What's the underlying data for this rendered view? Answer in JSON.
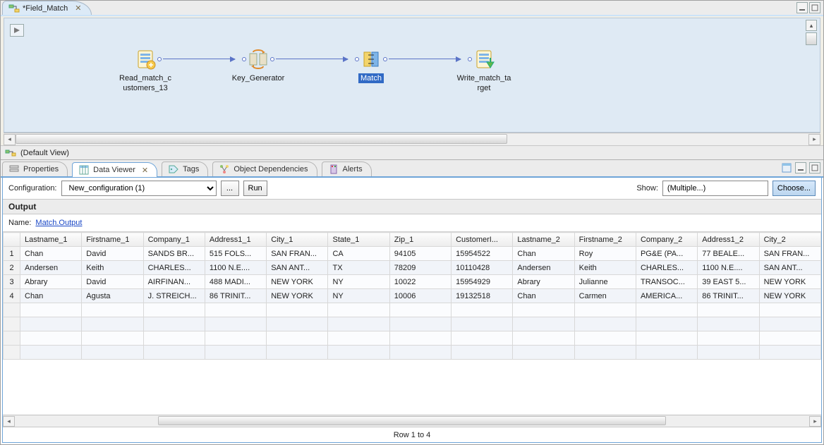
{
  "editor": {
    "tab_title": "*Field_Match",
    "default_view_label": "(Default View)",
    "nodes": {
      "read": "Read_match_customers_13",
      "keygen": "Key_Generator",
      "match": "Match",
      "write": "Write_match_target"
    }
  },
  "bottom_tabs": {
    "properties": "Properties",
    "data_viewer": "Data Viewer",
    "tags": "Tags",
    "object_deps": "Object Dependencies",
    "alerts": "Alerts"
  },
  "config_bar": {
    "config_label": "Configuration:",
    "config_value": "New_configuration (1)",
    "ellipsis": "...",
    "run": "Run",
    "show_label": "Show:",
    "show_value": "(Multiple...)",
    "choose": "Choose..."
  },
  "output": {
    "section": "Output",
    "name_label": "Name:",
    "name_value": "Match.Output",
    "status": "Row 1 to 4",
    "columns": [
      "Lastname_1",
      "Firstname_1",
      "Company_1",
      "Address1_1",
      "City_1",
      "State_1",
      "Zip_1",
      "CustomerI...",
      "Lastname_2",
      "Firstname_2",
      "Company_2",
      "Address1_2",
      "City_2"
    ],
    "rows": [
      [
        "Chan",
        "David",
        "SANDS BR...",
        "515 FOLS...",
        "SAN FRAN...",
        "CA",
        "94105",
        "15954522",
        "Chan",
        "Roy",
        "PG&E (PA...",
        "77 BEALE...",
        "SAN FRAN..."
      ],
      [
        "Andersen",
        "Keith",
        "CHARLES...",
        "1100 N.E....",
        "SAN ANT...",
        "TX",
        "78209",
        "10110428",
        "Andersen",
        "Keith",
        "CHARLES...",
        "1100 N.E....",
        "SAN ANT..."
      ],
      [
        "Abrary",
        "David",
        "AIRFINAN...",
        "488 MADI...",
        "NEW YORK",
        "NY",
        "10022",
        "15954929",
        "Abrary",
        "Julianne",
        "TRANSOC...",
        "39 EAST 5...",
        "NEW YORK"
      ],
      [
        "Chan",
        "Agusta",
        "J. STREICH...",
        "86 TRINIT...",
        "NEW YORK",
        "NY",
        "10006",
        "19132518",
        "Chan",
        "Carmen",
        "AMERICA...",
        "86 TRINIT...",
        "NEW YORK"
      ]
    ]
  }
}
